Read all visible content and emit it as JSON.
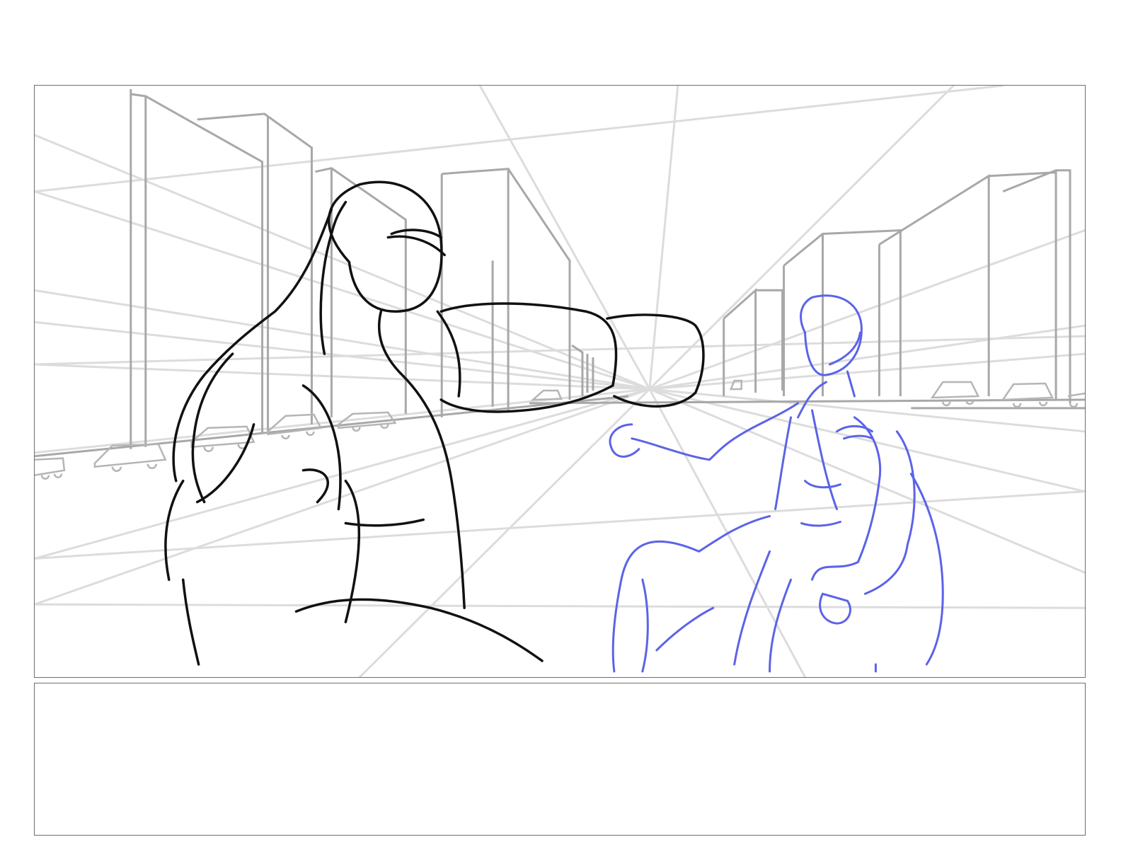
{
  "storyboard": {
    "panels": [
      {
        "id": "panel-1",
        "kind": "sketch",
        "content": "city-street-fight-sketch",
        "notes": ""
      },
      {
        "id": "panel-2",
        "kind": "notes",
        "notes": ""
      }
    ],
    "colors": {
      "page": "#ffffff",
      "frame_border": "#6e6e6e",
      "perspective_lines": "#d9d9d9",
      "buildings": "#a8a8a8",
      "foreground_figure": "#111111",
      "hero_figure": "#5b63e8"
    }
  }
}
